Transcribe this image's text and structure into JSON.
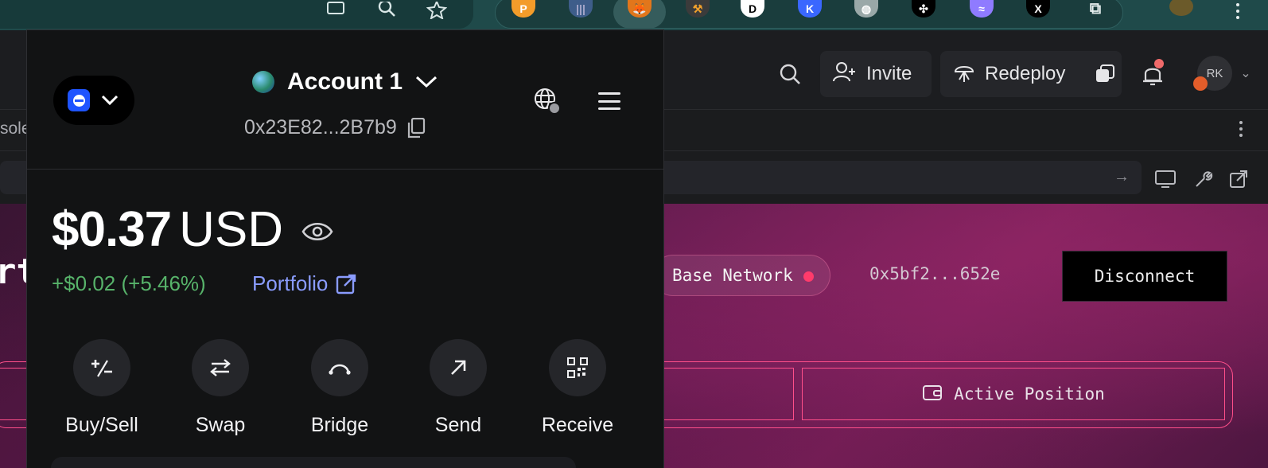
{
  "browser": {
    "extensions": [
      "screen-cast-icon",
      "search-icon",
      "star-icon",
      "coin-icon",
      "wallet-icon",
      "fox-icon",
      "tool-icon",
      "d-icon",
      "k-icon",
      "globe-icon",
      "puzzle-grid-icon",
      "wave-icon",
      "x-icon",
      "extensions-puzzle-icon",
      "profile-avatar-icon"
    ]
  },
  "header": {
    "invite_label": "Invite",
    "redeploy_label": "Redeploy",
    "avatar_initials": "RK"
  },
  "tab_row": {
    "partial_label": "sole"
  },
  "preview": {
    "big_letter": "rt",
    "network_label": "Base Network",
    "address": "0x5bf2...652e",
    "disconnect_label": "Disconnect",
    "active_position_label": "Active Position"
  },
  "metamask": {
    "account_name": "Account 1",
    "account_address": "0x23E82...2B7b9",
    "balance_amount": "$0.37",
    "balance_currency": "USD",
    "change_text": "+$0.02 (+5.46%)",
    "portfolio_label": "Portfolio",
    "actions": [
      {
        "label": "Buy/Sell",
        "icon": "plus-minus-icon"
      },
      {
        "label": "Swap",
        "icon": "swap-arrows-icon"
      },
      {
        "label": "Bridge",
        "icon": "bridge-icon"
      },
      {
        "label": "Send",
        "icon": "arrow-up-right-icon"
      },
      {
        "label": "Receive",
        "icon": "qr-code-icon"
      }
    ]
  },
  "colors": {
    "accent_pink": "#ff4f8a",
    "gain_green": "#57b36a",
    "link_blue": "#8a9cff",
    "base_blue": "#1f54ff"
  }
}
